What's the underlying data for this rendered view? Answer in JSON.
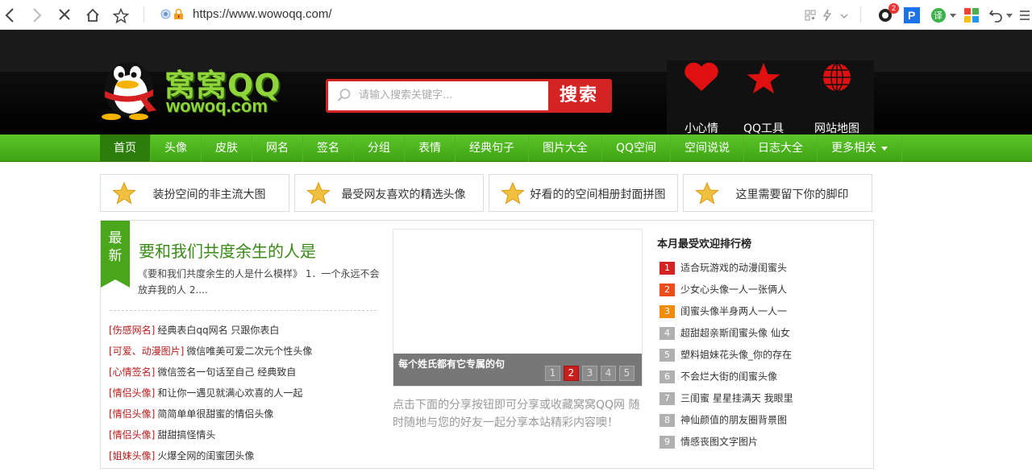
{
  "browser": {
    "url": "https://www.wowoqq.com/",
    "badge_count": "2",
    "translate_label": "译"
  },
  "header": {
    "logo_cn": "窝窝QQ",
    "logo_en": "wowoq.com",
    "search_placeholder": "请输入搜索关键字...",
    "search_button": "搜索",
    "links": [
      {
        "label": "小心情",
        "icon": "heart-icon"
      },
      {
        "label": "QQ工具",
        "icon": "star-icon"
      },
      {
        "label": "网站地图",
        "icon": "globe-icon"
      }
    ]
  },
  "nav": {
    "items": [
      "首页",
      "头像",
      "皮肤",
      "网名",
      "签名",
      "分组",
      "表情",
      "经典句子",
      "图片大全",
      "QQ空间",
      "空间说说",
      "日志大全",
      "更多相关"
    ],
    "active_index": 0
  },
  "features": [
    "装扮空间的非主流大图",
    "最受网友喜欢的精选头像",
    "好看的的空间相册封面拼图",
    "这里需要留下你的脚印"
  ],
  "latest": {
    "tag_line1": "最",
    "tag_line2": "新",
    "headline": "要和我们共度余生的人是",
    "desc": "《要和我们共度余生的人是什么模样》 1．一个永远不会放弃我的人 2...."
  },
  "news": [
    {
      "cat": "[伤感网名]",
      "title": "经典表白qq网名 只跟你表白"
    },
    {
      "cat": "[可爱、动漫图片]",
      "title": "微信唯美可爱二次元个性头像"
    },
    {
      "cat": "[心情签名]",
      "title": "微信签名一句话至自己 经典致自"
    },
    {
      "cat": "[情侣头像]",
      "title": "和让你一遇见就满心欢喜的人一起"
    },
    {
      "cat": "[情侣头像]",
      "title": "简简单单很甜蜜的情侣头像"
    },
    {
      "cat": "[情侣头像]",
      "title": "甜甜搞怪情头"
    },
    {
      "cat": "[姐妹头像]",
      "title": "火爆全网的闺蜜团头像"
    }
  ],
  "slider": {
    "caption": "每个姓氏都有它专属的句",
    "pages": [
      "1",
      "2",
      "3",
      "4",
      "5"
    ],
    "active_page": 1
  },
  "share": "点击下面的分享按钮即可分享或收藏窝窝QQ网 随时随地与您的好友一起分享本站精彩内容噢！",
  "rank": {
    "title": "本月最受欢迎排行榜",
    "items": [
      "适合玩游戏的动漫闺蜜头",
      "少女心头像一人一张俩人",
      "闺蜜头像半身两人一人一",
      "超甜超亲斯闺蜜头像 仙女",
      "塑料姐妹花头像_你的存在",
      "不会烂大街的闺蜜头像",
      "三闺蜜 星星挂满天 我眼里",
      "神仙颜值的朋友圈背景图",
      "情感丧图文字图片"
    ]
  },
  "colors": {
    "nav_green": "#4aa61b",
    "accent_red": "#d42323",
    "category_red": "#b51b1b"
  }
}
